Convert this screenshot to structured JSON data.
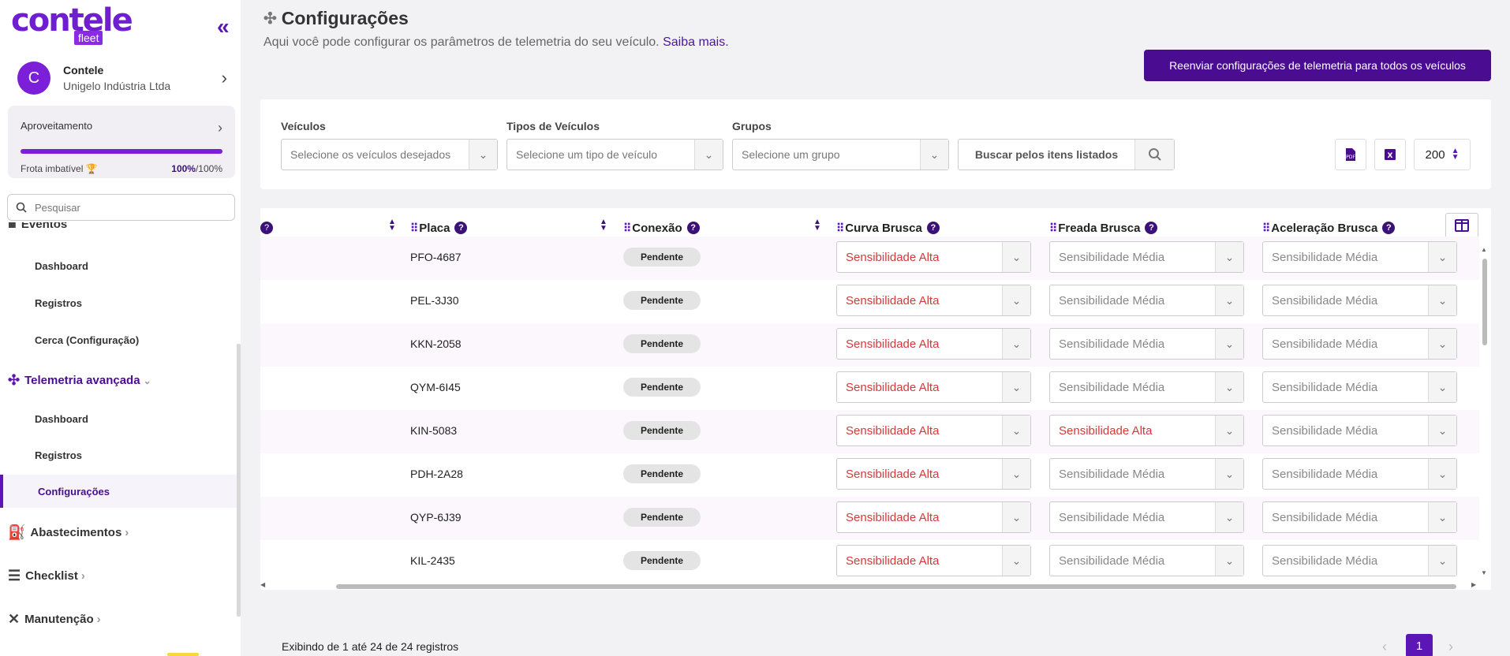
{
  "brand": {
    "word": "contele",
    "sub": "fleet",
    "primary": "#5b16b5",
    "accent": "#7c1fd8"
  },
  "account": {
    "initial": "C",
    "name": "Contele",
    "company": "Unigelo Indústria Ltda"
  },
  "performance": {
    "label": "Aproveitamento",
    "status": "Frota imbatível 🏆",
    "value": "100%",
    "total": "/100%",
    "level": 100
  },
  "sidebar": {
    "search_placeholder": "Pesquisar",
    "cut_label": "Eventos",
    "items": {
      "ev_dashboard": "Dashboard",
      "ev_registros": "Registros",
      "ev_cerca": "Cerca (Configuração)",
      "telemetria": "Telemetria avançada",
      "tel_dashboard": "Dashboard",
      "tel_registros": "Registros",
      "tel_config": "Configurações",
      "abastecimentos": "Abastecimentos",
      "checklist": "Checklist",
      "manutencao": "Manutenção"
    }
  },
  "header": {
    "title": "Configurações",
    "subtitle": "Aqui você pode configurar os parâmetros de telemetria do seu veículo.",
    "link": "Saiba mais.",
    "resend_button": "Reenviar configurações de telemetria para todos os veículos"
  },
  "filters": {
    "vehicles": {
      "label": "Veículos",
      "placeholder": "Selecione os veículos desejados"
    },
    "types": {
      "label": "Tipos de Veículos",
      "placeholder": "Selecione um tipo de veículo"
    },
    "groups": {
      "label": "Grupos",
      "placeholder": "Selecione um grupo"
    },
    "search": "Buscar pelos itens listados",
    "page_size": "200"
  },
  "table": {
    "columns": {
      "placa": "Placa",
      "conexao": "Conexão",
      "curva": "Curva Brusca",
      "freada": "Freada Brusca",
      "aceleracao": "Aceleração Brusca"
    },
    "rows": [
      {
        "placa": "PFO-4687",
        "conexao": "Pendente",
        "curva": "Sensibilidade Alta",
        "freada": "Sensibilidade Média",
        "aceleracao": "Sensibilidade Média"
      },
      {
        "placa": "PEL-3J30",
        "conexao": "Pendente",
        "curva": "Sensibilidade Alta",
        "freada": "Sensibilidade Média",
        "aceleracao": "Sensibilidade Média"
      },
      {
        "placa": "KKN-2058",
        "conexao": "Pendente",
        "curva": "Sensibilidade Alta",
        "freada": "Sensibilidade Média",
        "aceleracao": "Sensibilidade Média"
      },
      {
        "placa": "QYM-6I45",
        "conexao": "Pendente",
        "curva": "Sensibilidade Alta",
        "freada": "Sensibilidade Média",
        "aceleracao": "Sensibilidade Média"
      },
      {
        "placa": "KIN-5083",
        "conexao": "Pendente",
        "curva": "Sensibilidade Alta",
        "freada": "Sensibilidade Alta",
        "aceleracao": "Sensibilidade Média"
      },
      {
        "placa": "PDH-2A28",
        "conexao": "Pendente",
        "curva": "Sensibilidade Alta",
        "freada": "Sensibilidade Média",
        "aceleracao": "Sensibilidade Média"
      },
      {
        "placa": "QYP-6J39",
        "conexao": "Pendente",
        "curva": "Sensibilidade Alta",
        "freada": "Sensibilidade Média",
        "aceleracao": "Sensibilidade Média"
      },
      {
        "placa": "KIL-2435",
        "conexao": "Pendente",
        "curva": "Sensibilidade Alta",
        "freada": "Sensibilidade Média",
        "aceleracao": "Sensibilidade Média"
      }
    ]
  },
  "footer": {
    "info": "Exibindo de 1 até 24 de 24 registros",
    "current_page": "1"
  }
}
